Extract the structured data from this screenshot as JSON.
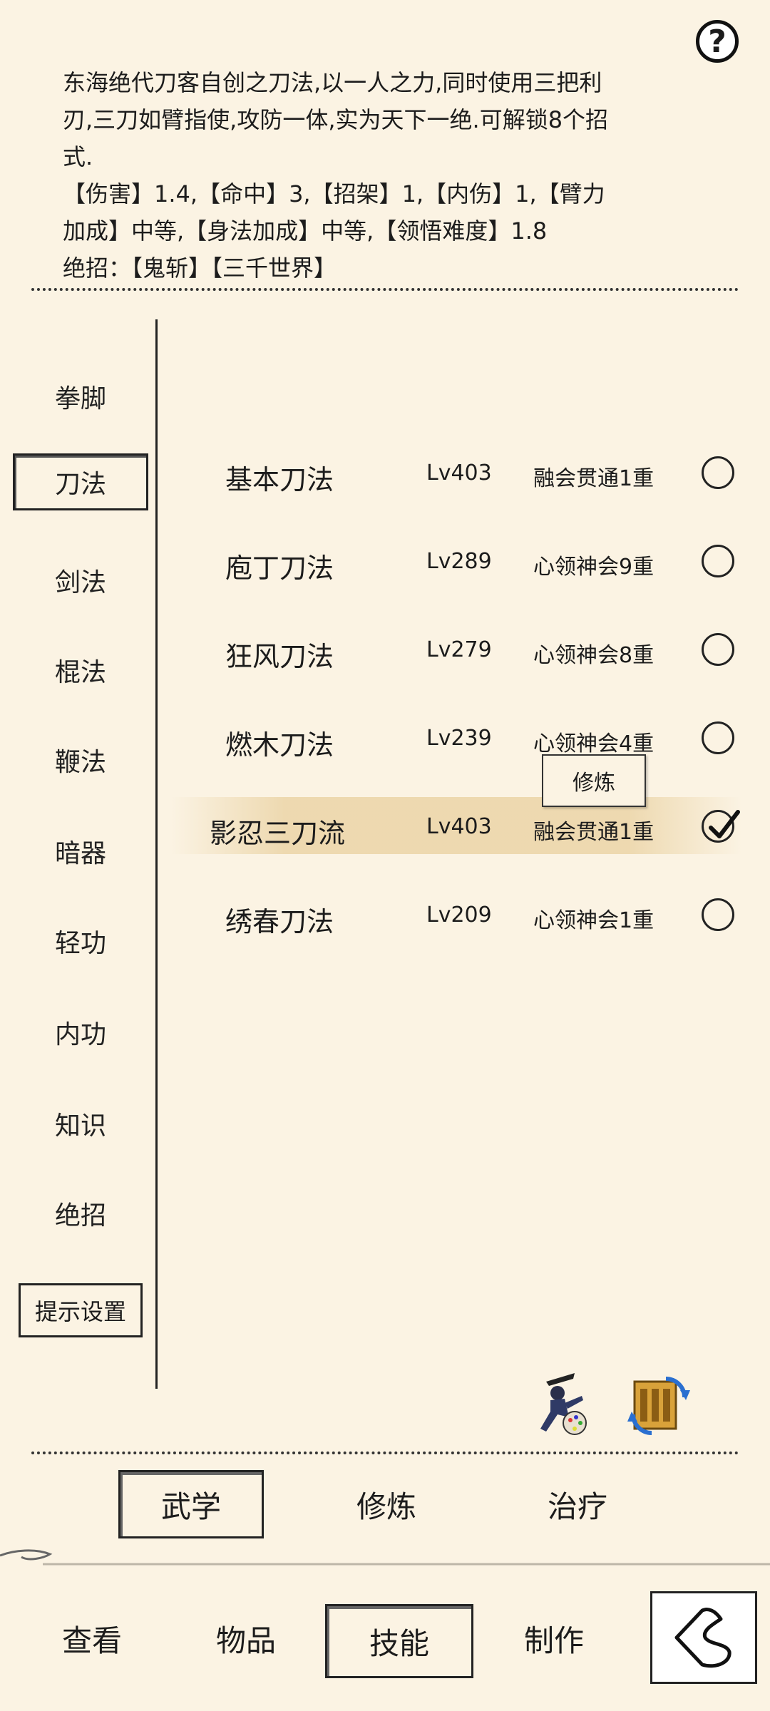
{
  "help": {
    "label": "?"
  },
  "description": {
    "line1": "东海绝代刀客自创之刀法,以一人之力,同时使用三把利",
    "line2": "刃,三刀如臂指使,攻防一体,实为天下一绝.可解锁8个招",
    "line3": "式.",
    "line4": "【伤害】1.4,【命中】3,【招架】1,【内伤】1,【臂力",
    "line5": "加成】中等,【身法加成】中等,【领悟难度】1.8",
    "line6": "绝招：【鬼斩】【三千世界】"
  },
  "categories": [
    "拳脚",
    "刀法",
    "剑法",
    "棍法",
    "鞭法",
    "暗器",
    "轻功",
    "内功",
    "知识",
    "绝招"
  ],
  "active_category": "刀法",
  "hint_button": "提示设置",
  "skills": [
    {
      "name": "基本刀法",
      "level": "Lv403",
      "realm": "融会贯通1重",
      "checked": false
    },
    {
      "name": "庖丁刀法",
      "level": "Lv289",
      "realm": "心领神会9重",
      "checked": false
    },
    {
      "name": "狂风刀法",
      "level": "Lv279",
      "realm": "心领神会8重",
      "checked": false
    },
    {
      "name": "燃木刀法",
      "level": "Lv239",
      "realm": "心领神会4重",
      "checked": false
    },
    {
      "name": "影忍三刀流",
      "level": "Lv403",
      "realm": "融会贯通1重",
      "checked": true
    },
    {
      "name": "绣春刀法",
      "level": "Lv209",
      "realm": "心领神会1重",
      "checked": false
    }
  ],
  "practice_popup": "修炼",
  "icons": {
    "ninja": "ninja-paint-icon",
    "swap": "scroll-swap-icon",
    "back": "back-arrow-icon"
  },
  "sub_tabs": {
    "martial": "武学",
    "practice": "修炼",
    "heal": "治疗"
  },
  "bottom_nav": {
    "view": "查看",
    "items": "物品",
    "skills": "技能",
    "craft": "制作"
  }
}
